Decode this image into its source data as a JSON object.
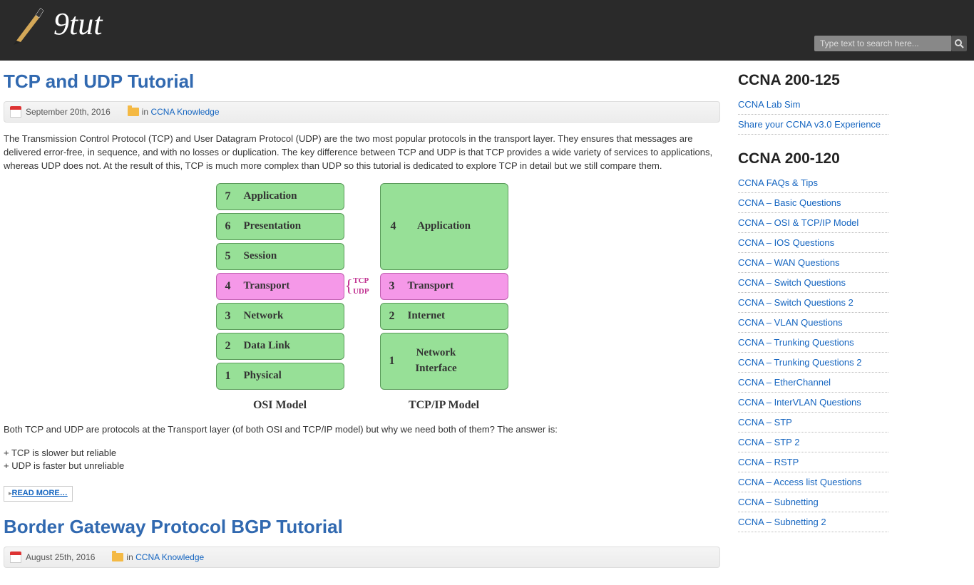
{
  "site": {
    "name": "9tut"
  },
  "search": {
    "placeholder": "Type text to search here..."
  },
  "articles": [
    {
      "title": "TCP and UDP Tutorial",
      "date": "September 20th, 2016",
      "in_label": "in",
      "category": "CCNA Knowledge",
      "intro": "The Transmission Control Protocol (TCP) and User Datagram Protocol (UDP) are the two most popular protocols in the transport layer. They ensures that messages are delivered error-free, in sequence, and with no losses or duplication. The key difference between TCP and UDP is that TCP provides a wide variety of services to applications, whereas UDP does not. At the result of this, TCP is much more complex than UDP so this tutorial is dedicated to explore TCP in detail but we still compare them.",
      "diagram": {
        "osi_label": "OSI Model",
        "tcpip_label": "TCP/IP Model",
        "badge_tcp": "TCP",
        "badge_udp": "UDP",
        "osi": [
          {
            "n": "7",
            "name": "Application"
          },
          {
            "n": "6",
            "name": "Presentation"
          },
          {
            "n": "5",
            "name": "Session"
          },
          {
            "n": "4",
            "name": "Transport"
          },
          {
            "n": "3",
            "name": "Network"
          },
          {
            "n": "2",
            "name": "Data Link"
          },
          {
            "n": "1",
            "name": "Physical"
          }
        ],
        "tcpip": [
          {
            "n": "4",
            "name": "Application"
          },
          {
            "n": "3",
            "name": "Transport"
          },
          {
            "n": "2",
            "name": "Internet"
          },
          {
            "n": "1",
            "name": "Network Interface"
          }
        ]
      },
      "para2": "Both TCP and UDP are protocols at the Transport layer (of both OSI and TCP/IP model) but why we need both of them? The answer is:",
      "bullet1": "+ TCP is slower but reliable",
      "bullet2": "+ UDP is faster but unreliable",
      "readmore": "READ MORE…"
    },
    {
      "title": "Border Gateway Protocol BGP Tutorial",
      "date": "August 25th, 2016",
      "in_label": "in",
      "category": "CCNA Knowledge"
    }
  ],
  "sidebar": {
    "section1": {
      "title": "CCNA 200-125",
      "links": [
        "CCNA Lab Sim",
        "Share your CCNA v3.0 Experience"
      ]
    },
    "section2": {
      "title": "CCNA 200-120",
      "links": [
        "CCNA FAQs & Tips",
        "CCNA – Basic Questions",
        "CCNA – OSI & TCP/IP Model",
        "CCNA – IOS Questions",
        "CCNA – WAN Questions",
        "CCNA – Switch Questions",
        "CCNA – Switch Questions 2",
        "CCNA – VLAN Questions",
        "CCNA – Trunking Questions",
        "CCNA – Trunking Questions 2",
        "CCNA – EtherChannel",
        "CCNA – InterVLAN Questions",
        "CCNA – STP",
        "CCNA – STP 2",
        "CCNA – RSTP",
        "CCNA – Access list Questions",
        "CCNA – Subnetting",
        "CCNA – Subnetting 2"
      ]
    }
  }
}
